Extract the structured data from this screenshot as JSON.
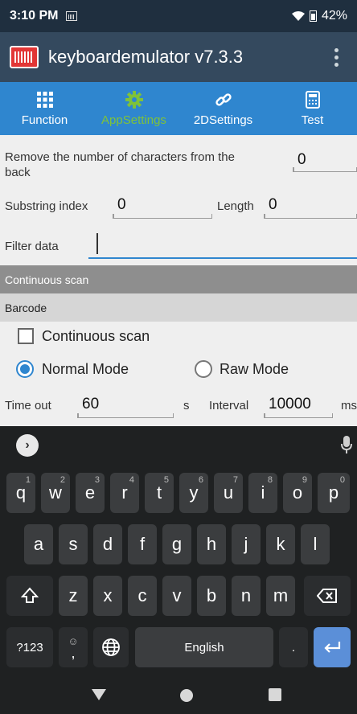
{
  "status": {
    "time": "3:10 PM",
    "battery": "42%"
  },
  "app": {
    "title": "keyboardemulator v7.3.3"
  },
  "tabs": [
    {
      "label": "Function",
      "icon": "grid-icon",
      "active": false
    },
    {
      "label": "AppSettings",
      "icon": "gear-icon",
      "active": true
    },
    {
      "label": "2DSettings",
      "icon": "link-icon",
      "active": false
    },
    {
      "label": "Test",
      "icon": "calculator-icon",
      "active": false
    }
  ],
  "settings": {
    "remove_back_label": "Remove the number of characters from the back",
    "remove_back_value": "0",
    "substring_index_label": "Substring index",
    "substring_index_value": "0",
    "length_label": "Length",
    "length_value": "0",
    "filter_label": "Filter data",
    "filter_value": ""
  },
  "sections": {
    "continuous_scan": "Continuous scan",
    "barcode": "Barcode"
  },
  "options": {
    "continuous_scan_label": "Continuous scan",
    "continuous_scan_checked": false,
    "normal_mode_label": "Normal Mode",
    "normal_mode_selected": true,
    "raw_mode_label": "Raw Mode",
    "raw_mode_selected": false
  },
  "timing": {
    "timeout_label": "Time out",
    "timeout_value": "60",
    "timeout_unit": "s",
    "interval_label": "Interval",
    "interval_value": "10000",
    "interval_unit": "ms"
  },
  "keyboard": {
    "row1": [
      {
        "key": "q",
        "hint": "1"
      },
      {
        "key": "w",
        "hint": "2"
      },
      {
        "key": "e",
        "hint": "3"
      },
      {
        "key": "r",
        "hint": "4"
      },
      {
        "key": "t",
        "hint": "5"
      },
      {
        "key": "y",
        "hint": "6"
      },
      {
        "key": "u",
        "hint": "7"
      },
      {
        "key": "i",
        "hint": "8"
      },
      {
        "key": "o",
        "hint": "9"
      },
      {
        "key": "p",
        "hint": "0"
      }
    ],
    "row2": [
      "a",
      "s",
      "d",
      "f",
      "g",
      "h",
      "j",
      "k",
      "l"
    ],
    "row3": [
      "z",
      "x",
      "c",
      "v",
      "b",
      "n",
      "m"
    ],
    "symbols_label": "?123",
    "emoji_hint": "☺",
    "comma": ",",
    "space_label": "English",
    "period": "."
  }
}
